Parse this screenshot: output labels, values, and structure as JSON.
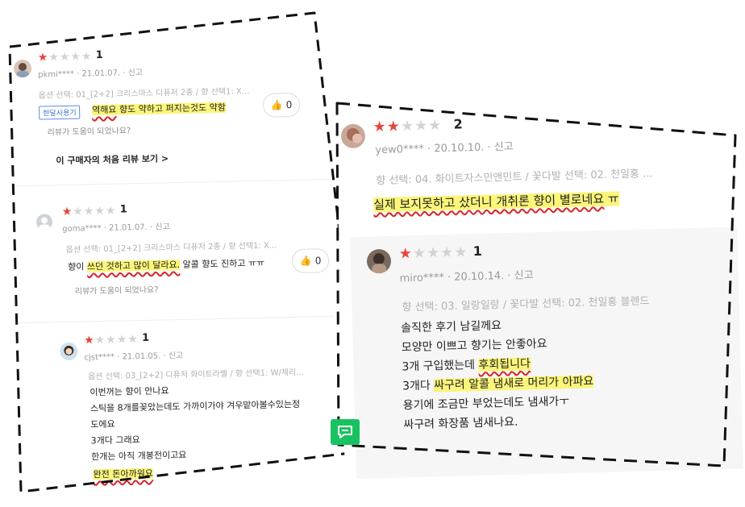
{
  "left_card": {
    "reviews": [
      {
        "rating": 1,
        "rating_label": "1",
        "user": "pkmi****",
        "date": "21.01.07.",
        "report": "신고",
        "option": "옵션 선택: 01_[2+2] 크리스마스 디퓨저 2종 / 향 선택1: X...",
        "tag": "한달사용기",
        "body_lines": [
          {
            "pre": "",
            "hl": "역해요",
            "post": " 향도 약하고 퍼지는것도 약함",
            "hl2": ""
          }
        ],
        "like_count": "0",
        "helpful": "리뷰가 도움이 되었나요?",
        "first_review_link": "이 구매자의 처음 리뷰 보기 >"
      },
      {
        "rating": 1,
        "rating_label": "1",
        "user": "goma****",
        "date": "21.01.07.",
        "report": "신고",
        "option": "옵션 선택: 01_[2+2] 크리스마스 디퓨저 2종 / 향 선택1: X...",
        "body_pre": "향이 ",
        "body_hl": "쓰던 것하고 많이 달라요.",
        "body_post": " 알콜 향도 진하고 ㅠㅠ",
        "like_count": "0",
        "helpful": "리뷰가 도움이 되었나요?"
      },
      {
        "rating": 1,
        "rating_label": "1",
        "user": "cjst****",
        "date": "21.01.05.",
        "report": "신고",
        "option": "옵션 선택: 03_[2+2] 디퓨저 화이트라벨 / 향 선택1: W/체리...",
        "lines": [
          "이번꺼는 향이 안나요",
          "스틱을 8개를꽂았는데도 가까이가야 겨우맡아볼수있는정",
          "도에요",
          "3개다 그래요",
          "한개는 아직 개봉전이고요"
        ],
        "last_line": "완전 돈아까워요"
      }
    ]
  },
  "right_card": {
    "reviews": [
      {
        "rating": 2,
        "rating_label": "2",
        "user": "yew0****",
        "date": "20.10.10.",
        "report": "신고",
        "option": "향 선택: 04. 화이트자스민앤민트 / 꽃다발 선택: 02. 천일홍 ...",
        "body_hl": "실제 보지못하고 샀더니 개취론 향이 별로네요",
        "body_post": " ㅠ"
      },
      {
        "rating": 1,
        "rating_label": "1",
        "user": "miro****",
        "date": "20.10.14.",
        "report": "신고",
        "option": "향 선택: 03. 일랑일랑 / 꽃다발 선택: 02. 천일홍 블렌드",
        "line1": "솔직한 후기 남길께요",
        "line2": "모양만 이쁘고 향기는 안좋아요",
        "line3_pre": "3개 구입했는데 ",
        "line3_hl": "후회됩니다",
        "line4_pre": "3개다 ",
        "line4_hl": "싸구려 알콜 냄새로 머리가 아파요",
        "line5": "용기에 조금만 부었는데도 냄새가ㅜ",
        "line6": "싸구려 화장품 냄새나요."
      }
    ]
  },
  "icons": {
    "like": "thumbs-up-icon",
    "chat": "chat-icon"
  },
  "colors": {
    "star_on": "#e8443a",
    "star_off": "#d3d3d3",
    "highlight": "#fbf57a",
    "underline": "#d6252c",
    "chat_green": "#19c261"
  }
}
